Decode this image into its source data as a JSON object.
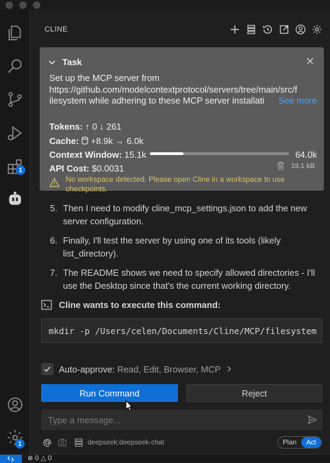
{
  "app": {
    "panel_title": "CLINE"
  },
  "task": {
    "title": "Task",
    "description_lines": [
      "Set up the MCP server from",
      "https://github.com/modelcontextprotocol/servers/tree/main/src/f",
      "ilesystem while adhering to these MCP server installati"
    ],
    "see_more": "See more",
    "tokens_label": "Tokens:",
    "tokens_in": "↑ 0",
    "tokens_out": "↓ 261",
    "cache_label": "Cache:",
    "cache_value": "+8.9k → 6.0k",
    "context_label": "Context Window:",
    "context_used": "15.1k",
    "context_max": "64.0k",
    "context_fraction": 0.24,
    "cost_label": "API Cost:",
    "cost_value": "$0.0031",
    "size": "19.1 kB",
    "warning": "No workspace detected. Please open Cline in a workspace to use checkpoints."
  },
  "steps": [
    {
      "num": "5.",
      "text": "Then I need to modify cline_mcp_settings.json to add the new server configuration."
    },
    {
      "num": "6.",
      "text": "Finally, I'll test the server by using one of its tools (likely list_directory)."
    },
    {
      "num": "7.",
      "text": "The README shows we need to specify allowed directories - I'll use the Desktop since that's the current working directory."
    }
  ],
  "command": {
    "title": "Cline wants to execute this command:",
    "text": "mkdir -p /Users/celen/Documents/Cline/MCP/filesystem"
  },
  "auto_approve": {
    "label": "Auto-approve:",
    "options": "Read, Edit, Browser, MCP"
  },
  "buttons": {
    "run": "Run Command",
    "reject": "Reject"
  },
  "input": {
    "placeholder": "Type a message..."
  },
  "model": "deepseek:deepseek-chat",
  "mode": {
    "plan": "Plan",
    "act": "Act"
  },
  "badges": {
    "extensions": "1",
    "settings": "1"
  },
  "status": {
    "errors": "0",
    "warnings": "0"
  },
  "colors": {
    "accent": "#0e6fd6",
    "warning": "#d6c36b",
    "link": "#4aa3ff",
    "task_bg": "#5b5b5b"
  }
}
